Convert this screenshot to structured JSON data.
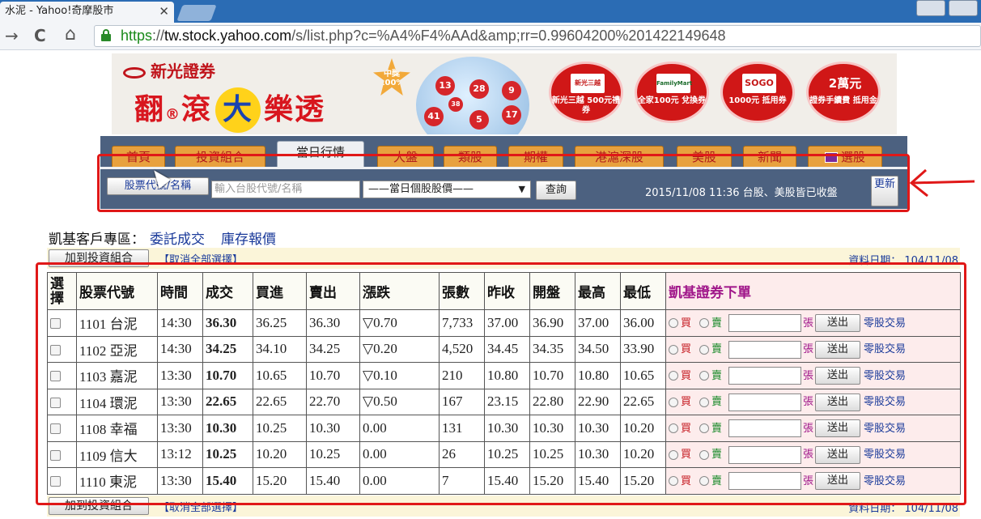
{
  "browser": {
    "tab_title": "水泥 - Yahoo!奇摩股市",
    "tab_close": "✕",
    "url_scheme": "https",
    "url_sep": "://",
    "url_host": "tw.stock.yahoo.com",
    "url_path": "/s/list.php?c=%A4%F4%AAd&amp;rr=0.99604200%201422149648",
    "back": "→",
    "reload": "C",
    "home": "⌂"
  },
  "banner": {
    "brand": "新光證券",
    "slogan_a": "翻",
    "slogan_b": "滾",
    "slogan_big": "大",
    "slogan_c": "樂透",
    "star": "中獎 100%",
    "balls": [
      "13",
      "28",
      "9",
      "38",
      "41",
      "5",
      "17"
    ],
    "promos": [
      {
        "pic": "新光三越",
        "text": "新光三越 500元禮券"
      },
      {
        "pic": "FamilyMart",
        "text": "全家100元 兌換券"
      },
      {
        "pic": "SOGO",
        "text": "1000元 抵用券"
      },
      {
        "pic": "2萬元",
        "text": "證券手續費 抵用金"
      }
    ]
  },
  "nav": {
    "tabs": [
      "首頁",
      "投資組合",
      "當日行情",
      "大盤",
      "類股",
      "期權",
      "港滬深股",
      "美股",
      "新聞",
      "選股"
    ],
    "active_tab": "當日行情"
  },
  "search": {
    "symbol_button": "股票代號/名稱",
    "input_placeholder": "輸入台股代號/名稱",
    "select_value": "——當日個股股價——",
    "select_arrow": "▼",
    "query_button": "查詢",
    "status": "2015/11/08 11:36 台股、美股皆已收盤",
    "refresh_button": "更新"
  },
  "client": {
    "title": "凱基客戶專區：",
    "link_orders": "委託成交",
    "link_inventory": "庫存報價",
    "add_button": "加到投資組合",
    "cancel_all": "【取消全部選擇】",
    "data_date": "資料日期： 104/11/08"
  },
  "table": {
    "headers": [
      "選擇",
      "股票代號",
      "時間",
      "成交",
      "買進",
      "賣出",
      "漲跌",
      "張數",
      "昨收",
      "開盤",
      "最高",
      "最低",
      "凱基證券下單"
    ],
    "rows": [
      {
        "symbol": "1101 台泥",
        "time": "14:30",
        "price": "36.30",
        "bid": "36.25",
        "ask": "36.30",
        "change": "▽0.70",
        "dir": "down",
        "volume": "7,733",
        "prev": "37.00",
        "open": "36.90",
        "high": "37.00",
        "low": "36.00"
      },
      {
        "symbol": "1102 亞泥",
        "time": "14:30",
        "price": "34.25",
        "bid": "34.10",
        "ask": "34.25",
        "change": "▽0.20",
        "dir": "down",
        "volume": "4,520",
        "prev": "34.45",
        "open": "34.35",
        "high": "34.50",
        "low": "33.90"
      },
      {
        "symbol": "1103 嘉泥",
        "time": "13:30",
        "price": "10.70",
        "bid": "10.65",
        "ask": "10.70",
        "change": "▽0.10",
        "dir": "down",
        "volume": "210",
        "prev": "10.80",
        "open": "10.70",
        "high": "10.80",
        "low": "10.65"
      },
      {
        "symbol": "1104 環泥",
        "time": "13:30",
        "price": "22.65",
        "bid": "22.65",
        "ask": "22.70",
        "change": "▽0.50",
        "dir": "down",
        "volume": "167",
        "prev": "23.15",
        "open": "22.80",
        "high": "22.90",
        "low": "22.65"
      },
      {
        "symbol": "1108 幸福",
        "time": "13:30",
        "price": "10.30",
        "bid": "10.25",
        "ask": "10.30",
        "change": "0.00",
        "dir": "flat",
        "volume": "131",
        "prev": "10.30",
        "open": "10.30",
        "high": "10.30",
        "low": "10.20"
      },
      {
        "symbol": "1109 信大",
        "time": "13:12",
        "price": "10.25",
        "bid": "10.20",
        "ask": "10.25",
        "change": "0.00",
        "dir": "flat",
        "volume": "26",
        "prev": "10.25",
        "open": "10.25",
        "high": "10.30",
        "low": "10.20"
      },
      {
        "symbol": "1110 東泥",
        "time": "13:30",
        "price": "15.40",
        "bid": "15.20",
        "ask": "15.40",
        "change": "0.00",
        "dir": "flat",
        "volume": "7",
        "prev": "15.40",
        "open": "15.20",
        "high": "15.40",
        "low": "15.20"
      }
    ],
    "order": {
      "buy": "買",
      "sell": "賣",
      "unit": "張",
      "send": "送出",
      "odd_lot": "零股交易"
    }
  },
  "colors": {
    "annotation": "#e01818",
    "nav_bg": "#4c6180",
    "tab_bg": "#e8a13e"
  }
}
